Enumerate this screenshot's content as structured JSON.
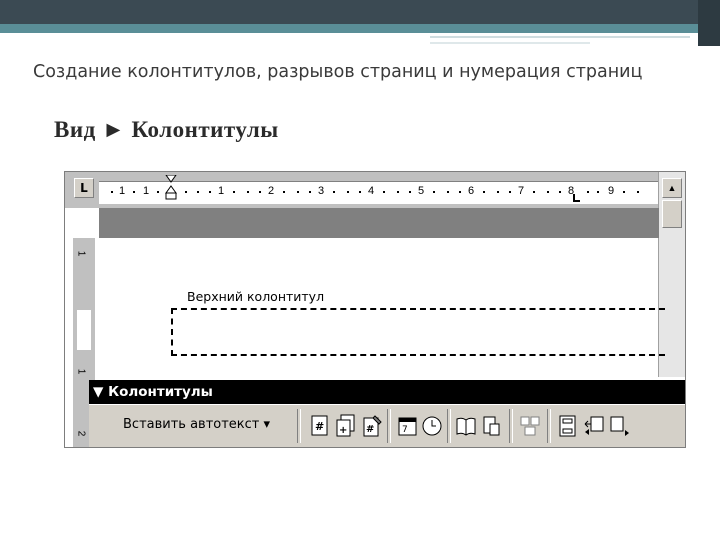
{
  "slide": {
    "title": "Создание колонтитулов, разрывов страниц и нумерация страниц",
    "subtitle": "Вид ► Колонтитулы"
  },
  "word": {
    "ruler": {
      "tab_glyph": "L",
      "numbers": [
        "1",
        "1",
        "1",
        "2",
        "3",
        "4",
        "5",
        "6",
        "7",
        "8",
        "9"
      ]
    },
    "vruler_numbers": [
      "1",
      "1",
      "2"
    ],
    "header_label": "Верхний колонтитул",
    "toolbar": {
      "title": "▼ Колонтитулы",
      "autotext_button": "Вставить автотекст ▾",
      "icons": [
        "insert-page-number-icon",
        "insert-page-count-icon",
        "format-page-number-icon",
        "insert-date-icon",
        "insert-time-icon",
        "page-setup-icon",
        "show-hide-text-icon",
        "same-as-previous-icon",
        "switch-header-footer-icon",
        "previous-icon",
        "next-icon"
      ]
    }
  }
}
